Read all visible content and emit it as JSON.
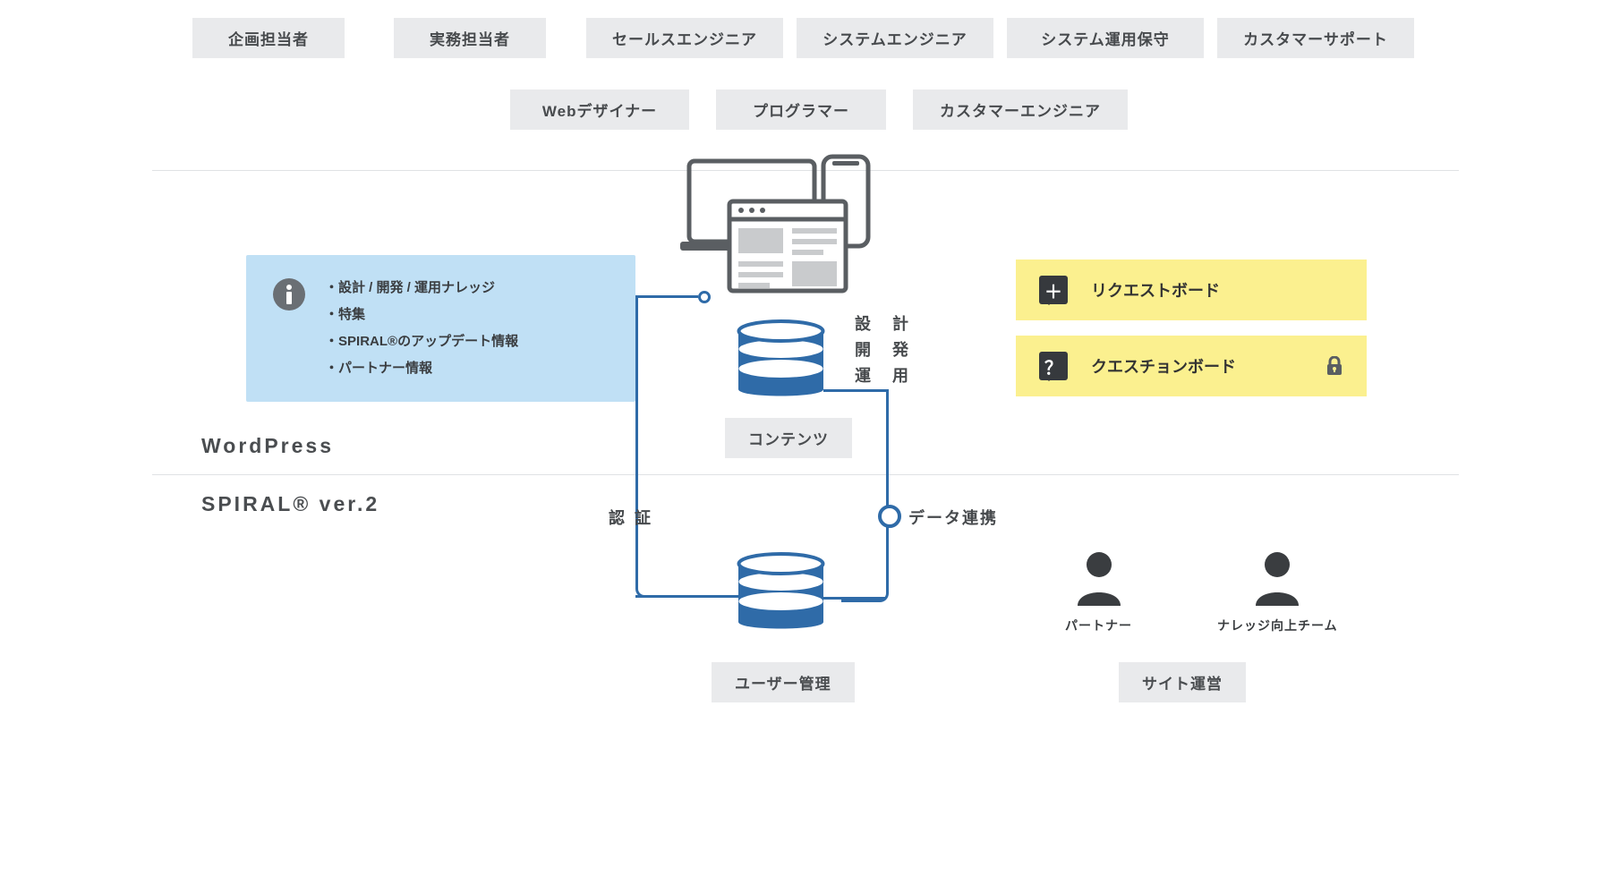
{
  "tags_row1": [
    "企画担当者",
    "実務担当者",
    "セールスエンジニア",
    "システムエンジニア",
    "システム運用保守",
    "カスタマーサポート"
  ],
  "tags_row2": [
    "Webデザイナー",
    "プログラマー",
    "カスタマーエンジニア"
  ],
  "info_items": [
    "設計 / 開発 / 運用ナレッジ",
    "特集",
    "SPIRAL®のアップデート情報",
    "パートナー情報"
  ],
  "section_wordpress": "WordPress",
  "section_spiral": "SPIRAL® ver.2",
  "contents_label": "コンテンツ",
  "user_mgmt_label": "ユーザー管理",
  "design_dev_ops": [
    "設　計",
    "開　発",
    "運　用"
  ],
  "auth_label": "認 証",
  "data_link_label": "データ連携",
  "yellow1": "リクエストボード",
  "yellow2": "クエスチョンボード",
  "person_partner": "パートナー",
  "person_team": "ナレッジ向上チーム",
  "site_ops_label": "サイト運営"
}
